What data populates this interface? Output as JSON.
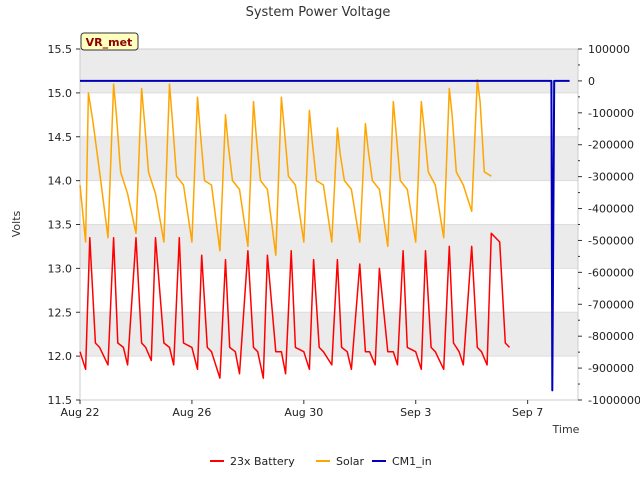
{
  "chart_data": {
    "type": "line",
    "title": "System Power Voltage",
    "xlabel": "Time",
    "ylabel": "Volts",
    "badge": "VR_met",
    "x_ticks": [
      "Aug 22",
      "Aug 26",
      "Aug 30",
      "Sep 3",
      "Sep 7"
    ],
    "x_tick_days": [
      0,
      4,
      8,
      12,
      16
    ],
    "x_range_days": [
      0,
      17.8
    ],
    "ylim_left": [
      11.5,
      15.5
    ],
    "y_ticks_left": [
      "11.5",
      "12.0",
      "12.5",
      "13.0",
      "13.5",
      "14.0",
      "14.5",
      "15.0",
      "15.5"
    ],
    "ylim_right": [
      -1000000,
      100000
    ],
    "y_ticks_right": [
      "-1000000",
      "-900000",
      "-800000",
      "-700000",
      "-600000",
      "-500000",
      "-400000",
      "-300000",
      "-200000",
      "-100000",
      "0",
      "100000"
    ],
    "grid": "horizontal bands",
    "legend_position": "bottom-center",
    "colors": {
      "battery": "#ff0000",
      "solar": "#ffa500",
      "cm1": "#0000bb",
      "band": "#ebebeb"
    },
    "series": [
      {
        "name": "23x Battery",
        "axis": "left",
        "days": [
          0.0,
          0.2,
          0.35,
          0.55,
          0.7,
          1.0,
          1.2,
          1.35,
          1.55,
          1.7,
          2.0,
          2.2,
          2.35,
          2.55,
          2.7,
          3.0,
          3.2,
          3.35,
          3.55,
          3.7,
          4.0,
          4.2,
          4.35,
          4.55,
          4.7,
          5.0,
          5.2,
          5.35,
          5.55,
          5.7,
          6.0,
          6.2,
          6.35,
          6.55,
          6.7,
          7.0,
          7.2,
          7.35,
          7.55,
          7.7,
          8.0,
          8.2,
          8.35,
          8.55,
          8.7,
          9.0,
          9.2,
          9.35,
          9.55,
          9.7,
          10.0,
          10.2,
          10.35,
          10.55,
          10.7,
          11.0,
          11.2,
          11.35,
          11.55,
          11.7,
          12.0,
          12.2,
          12.35,
          12.55,
          12.7,
          13.0,
          13.2,
          13.35,
          13.55,
          13.7,
          14.0,
          14.2,
          14.35,
          14.55,
          14.7,
          15.0,
          15.2,
          15.35,
          15.55,
          15.7,
          16.0,
          16.2,
          16.35,
          16.55,
          16.7,
          16.9,
          17.2
        ],
        "values": [
          12.05,
          11.85,
          13.35,
          12.15,
          12.1,
          11.9,
          13.35,
          12.15,
          12.1,
          11.9,
          13.35,
          12.15,
          12.1,
          11.95,
          13.35,
          12.15,
          12.1,
          11.9,
          13.35,
          12.15,
          12.1,
          11.85,
          13.15,
          12.1,
          12.05,
          11.75,
          13.1,
          12.1,
          12.05,
          11.8,
          13.2,
          12.1,
          12.05,
          11.75,
          13.15,
          12.05,
          12.05,
          11.8,
          13.2,
          12.1,
          12.05,
          11.85,
          13.1,
          12.1,
          12.05,
          11.9,
          13.1,
          12.1,
          12.05,
          11.85,
          13.05,
          12.05,
          12.05,
          11.9,
          13.0,
          12.05,
          12.05,
          11.9,
          13.2,
          12.1,
          12.05,
          11.85,
          13.2,
          12.1,
          12.05,
          11.85,
          13.25,
          12.15,
          12.05,
          11.9,
          13.25,
          12.1,
          12.05,
          11.9,
          13.4,
          13.3,
          12.15,
          12.1
        ]
      },
      {
        "name": "Solar",
        "axis": "left",
        "days": [
          0.0,
          0.2,
          0.3,
          0.45,
          0.7,
          1.0,
          1.2,
          1.3,
          1.45,
          1.7,
          2.0,
          2.2,
          2.3,
          2.45,
          2.7,
          3.0,
          3.2,
          3.3,
          3.45,
          3.7,
          4.0,
          4.2,
          4.3,
          4.45,
          4.7,
          5.0,
          5.2,
          5.3,
          5.45,
          5.7,
          6.0,
          6.2,
          6.3,
          6.45,
          6.7,
          7.0,
          7.2,
          7.3,
          7.45,
          7.7,
          8.0,
          8.2,
          8.3,
          8.45,
          8.7,
          9.0,
          9.2,
          9.3,
          9.45,
          9.7,
          10.0,
          10.2,
          10.3,
          10.45,
          10.7,
          11.0,
          11.2,
          11.3,
          11.45,
          11.7,
          12.0,
          12.2,
          12.3,
          12.45,
          12.7,
          13.0,
          13.2,
          13.3,
          13.45,
          13.7,
          14.0,
          14.2,
          14.3,
          14.45,
          14.7,
          15.0,
          15.2,
          15.3,
          15.45,
          15.7,
          16.0,
          16.2,
          16.3,
          16.45,
          16.6,
          16.8,
          17.2
        ],
        "values": [
          13.95,
          13.3,
          15.0,
          14.7,
          14.1,
          13.35,
          15.1,
          14.75,
          14.1,
          13.85,
          13.4,
          15.05,
          14.7,
          14.1,
          13.85,
          13.3,
          15.1,
          14.7,
          14.05,
          13.95,
          13.3,
          14.95,
          14.55,
          14.0,
          13.95,
          13.2,
          14.75,
          14.4,
          14.0,
          13.9,
          13.25,
          14.9,
          14.5,
          14.0,
          13.9,
          13.15,
          14.95,
          14.6,
          14.05,
          13.95,
          13.3,
          14.8,
          14.45,
          14.0,
          13.95,
          13.3,
          14.6,
          14.3,
          14.0,
          13.9,
          13.3,
          14.65,
          14.35,
          14.0,
          13.9,
          13.25,
          14.9,
          14.55,
          14.0,
          13.9,
          13.3,
          14.9,
          14.6,
          14.1,
          13.95,
          13.35,
          15.05,
          14.75,
          14.1,
          13.95,
          13.65,
          15.15,
          14.9,
          14.1,
          14.05
        ]
      },
      {
        "name": "CM1_in",
        "axis": "right",
        "days": [
          0.0,
          16.85,
          16.88,
          16.95,
          17.0,
          17.5
        ],
        "values": [
          0,
          0,
          -970000,
          0,
          0,
          0
        ]
      }
    ]
  }
}
